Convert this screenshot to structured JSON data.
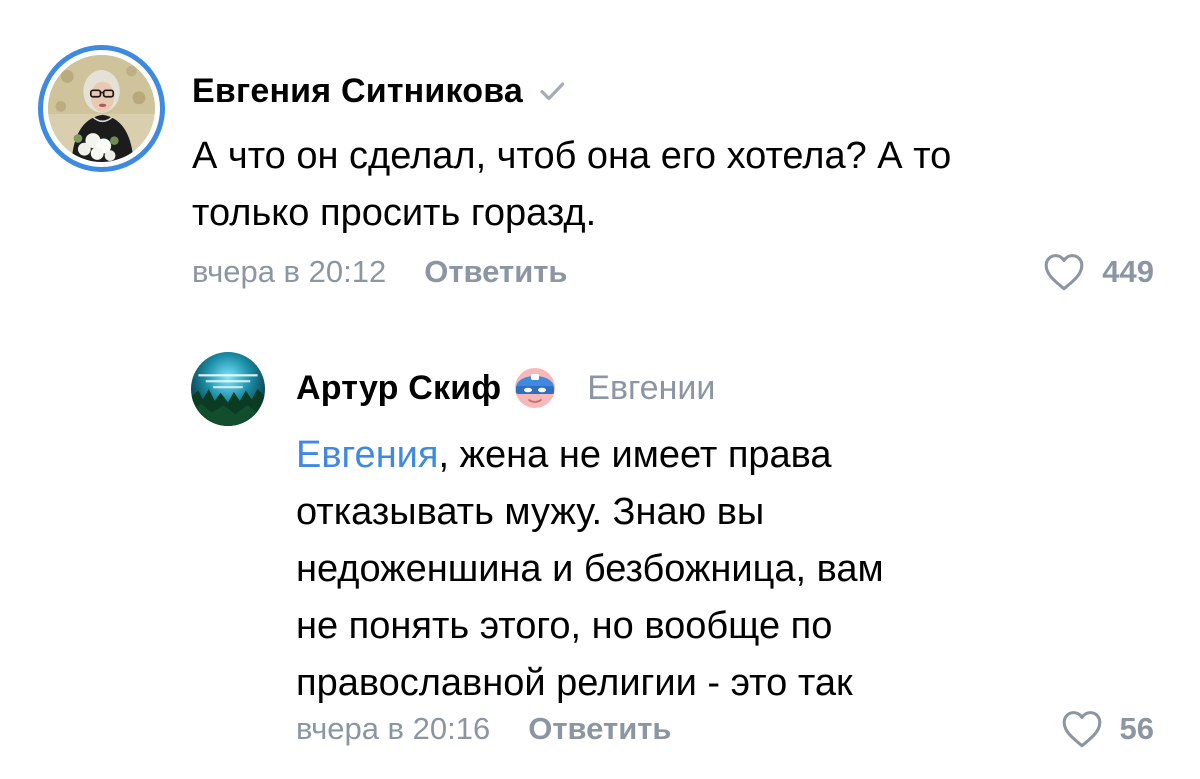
{
  "colors": {
    "accent": "#3f8ae0",
    "secondary_text": "#8c96a3",
    "text": "#000000"
  },
  "comments": [
    {
      "author": "Евгения Ситникова",
      "verified_icon": "checkmark-icon",
      "text": "А что он сделал, чтоб она его хотела? А то\nтолько просить горазд.",
      "time": "вчера в 20:12",
      "reply_label": "Ответить",
      "likes": "449",
      "like_icon": "heart-icon"
    },
    {
      "author": "Артур Скиф",
      "badge_icon": "mask-icon",
      "reply_to": "Евгении",
      "mention": "Евгения",
      "text": ", жена не имеет права\nотказывать мужу. Знаю вы\nнедоженшина и безбожница, вам\nне понять этого, но вообще по\nправославной религии - это так",
      "time": "вчера в 20:16",
      "reply_label": "Ответить",
      "likes": "56",
      "like_icon": "heart-icon"
    }
  ]
}
